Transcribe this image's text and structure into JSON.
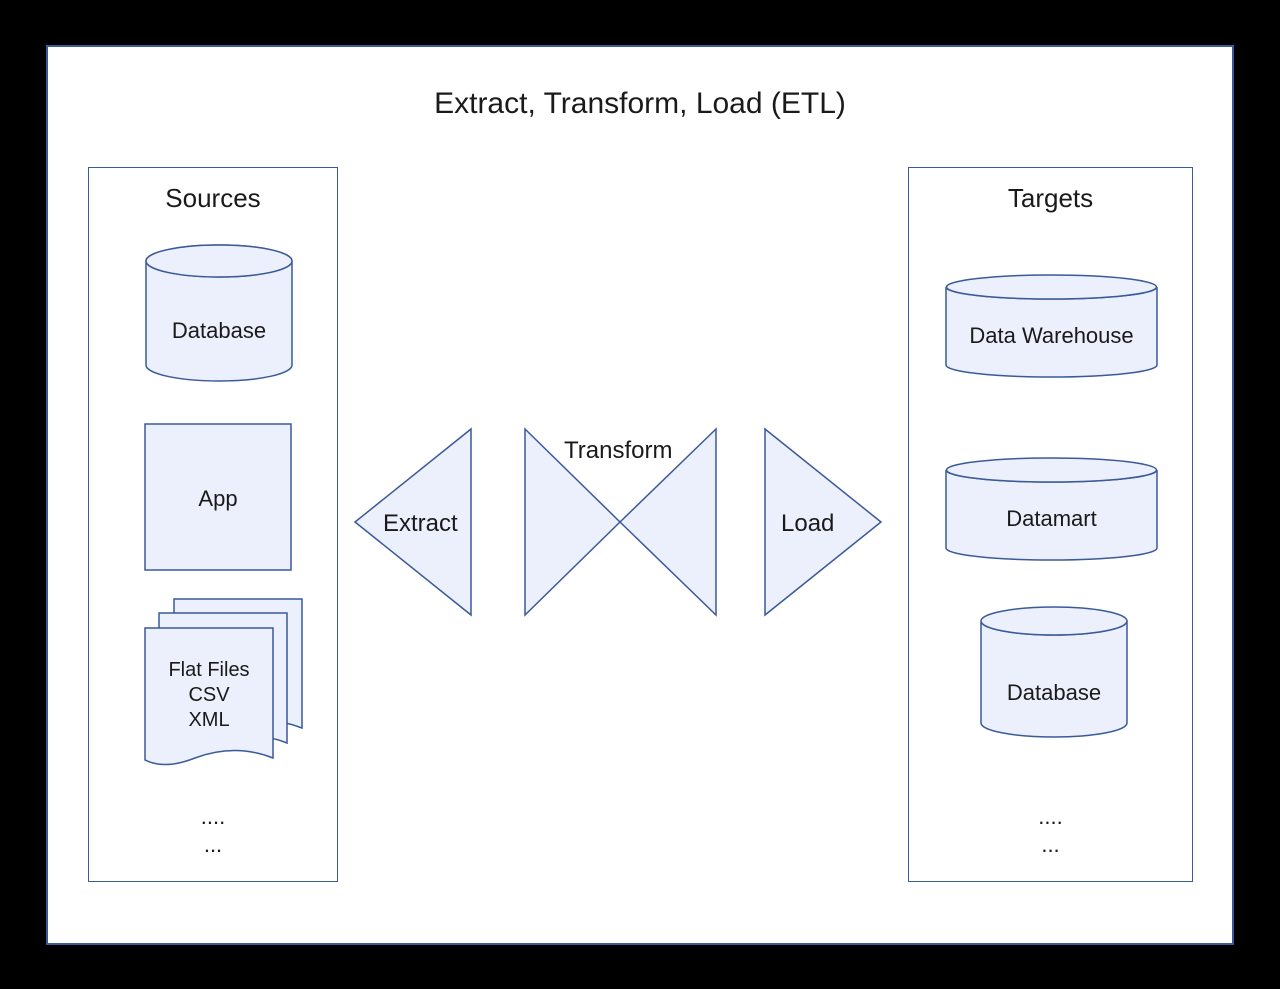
{
  "title": "Extract, Transform, Load (ETL)",
  "sources": {
    "heading": "Sources",
    "database": "Database",
    "app": "App",
    "flatfiles_l1": "Flat Files",
    "flatfiles_l2": "CSV",
    "flatfiles_l3": "XML",
    "ellipsis1": "....",
    "ellipsis2": "..."
  },
  "process": {
    "extract": "Extract",
    "transform": "Transform",
    "load": "Load"
  },
  "targets": {
    "heading": "Targets",
    "dw": "Data Warehouse",
    "datamart": "Datamart",
    "database": "Database",
    "ellipsis1": "....",
    "ellipsis2": "..."
  }
}
